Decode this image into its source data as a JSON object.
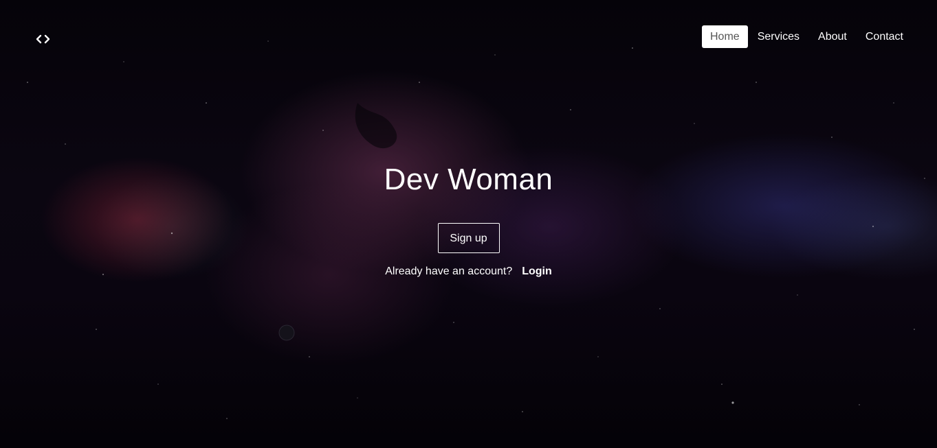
{
  "header": {
    "logo_icon": "code-brackets-icon",
    "nav": [
      {
        "label": "Home",
        "active": true
      },
      {
        "label": "Services",
        "active": false
      },
      {
        "label": "About",
        "active": false
      },
      {
        "label": "Contact",
        "active": false
      }
    ]
  },
  "hero": {
    "title": "Dev Woman",
    "signup_label": "Sign up",
    "account_prompt": "Already have an account?",
    "login_label": "Login",
    "background": "space-nebula-image"
  },
  "colors": {
    "text": "#ffffff",
    "active_nav_bg": "#ffffff",
    "active_nav_text": "#555555",
    "background_base": "#05030a"
  }
}
